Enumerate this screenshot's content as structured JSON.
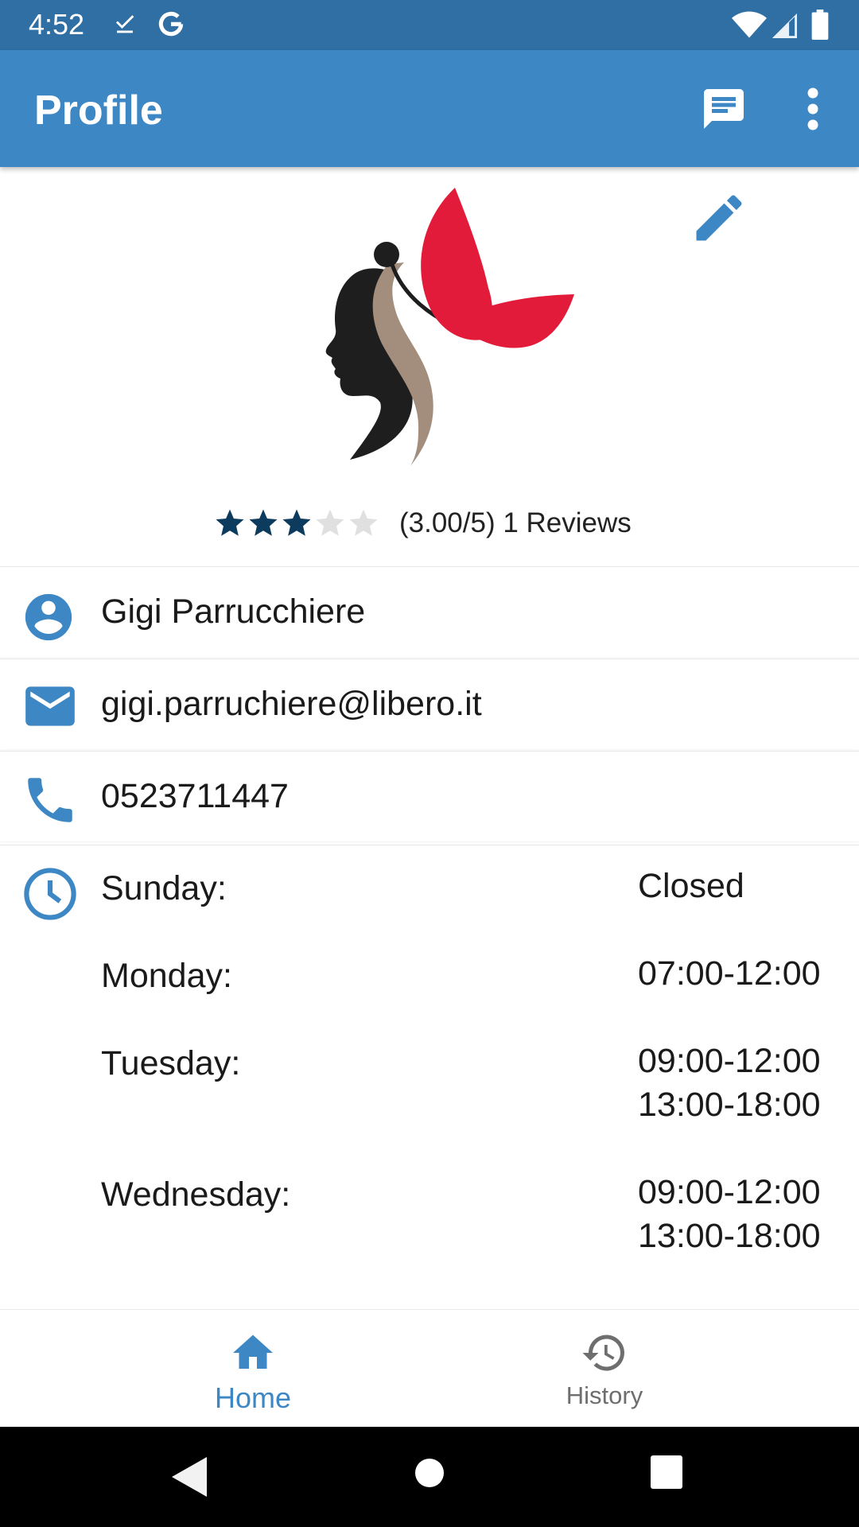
{
  "status_bar": {
    "time": "4:52",
    "icons": [
      "download-done-icon",
      "google-icon",
      "wifi-icon",
      "signal-icon",
      "battery-icon"
    ]
  },
  "app_bar": {
    "title": "Profile",
    "actions": [
      "chat-icon",
      "more-vert-icon"
    ],
    "color": "#3d88c4"
  },
  "profile": {
    "logo": "woman-butterfly-logo",
    "rating": {
      "value": 3,
      "max": 5,
      "text": "(3.00/5) 1 Reviews"
    },
    "name": "Gigi Parrucchiere",
    "email": "gigi.parruchiere@libero.it",
    "phone": "0523711447"
  },
  "hours": [
    {
      "day": "Sunday:",
      "hours": [
        "Closed"
      ]
    },
    {
      "day": "Monday:",
      "hours": [
        "07:00-12:00"
      ]
    },
    {
      "day": "Tuesday:",
      "hours": [
        "09:00-12:00",
        "13:00-18:00"
      ]
    },
    {
      "day": "Wednesday:",
      "hours": [
        "09:00-12:00",
        "13:00-18:00"
      ]
    }
  ],
  "bottom_nav": {
    "home_label": "Home",
    "history_label": "History",
    "active": "home"
  },
  "colors": {
    "primary": "#3d88c4",
    "status_bar": "#2f6fa3",
    "star_filled": "#0d3b5e",
    "star_empty": "#e0e0e0",
    "logo_red": "#e31b3b",
    "logo_tan": "#a38d7c"
  }
}
